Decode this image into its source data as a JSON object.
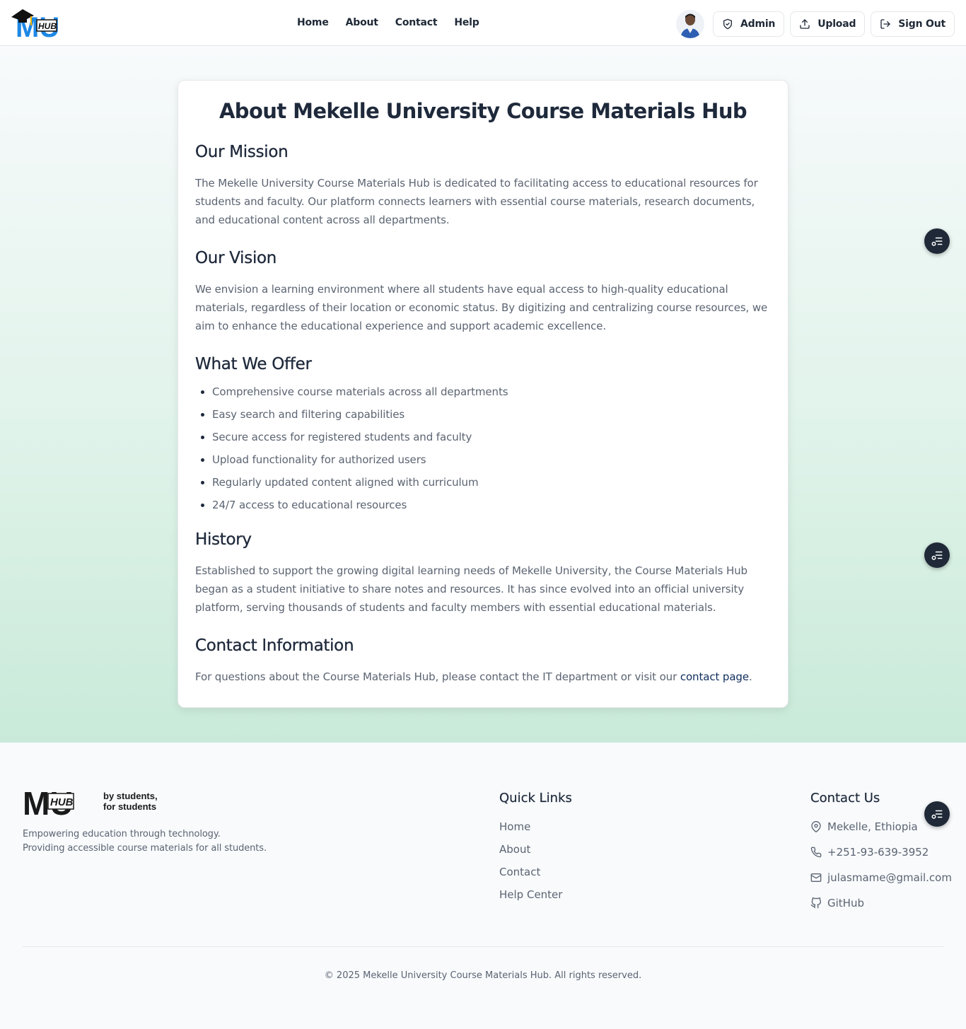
{
  "nav": {
    "links": [
      "Home",
      "About",
      "Contact",
      "Help"
    ],
    "admin_label": "Admin",
    "upload_label": "Upload",
    "signout_label": "Sign Out"
  },
  "content": {
    "title": "About Mekelle University Course Materials Hub",
    "mission_heading": "Our Mission",
    "mission_text": "The Mekelle University Course Materials Hub is dedicated to facilitating access to educational resources for students and faculty. Our platform connects learners with essential course materials, research documents, and educational content across all departments.",
    "vision_heading": "Our Vision",
    "vision_text": "We envision a learning environment where all students have equal access to high-quality educational materials, regardless of their location or economic status. By digitizing and centralizing course resources, we aim to enhance the educational experience and support academic excellence.",
    "offer_heading": "What We Offer",
    "offer_items": [
      "Comprehensive course materials across all departments",
      "Easy search and filtering capabilities",
      "Secure access for registered students and faculty",
      "Upload functionality for authorized users",
      "Regularly updated content aligned with curriculum",
      "24/7 access to educational resources"
    ],
    "history_heading": "History",
    "history_text": "Established to support the growing digital learning needs of Mekelle University, the Course Materials Hub began as a student initiative to share notes and resources. It has since evolved into an official university platform, serving thousands of students and faculty members with essential educational materials.",
    "contact_heading": "Contact Information",
    "contact_text_before": "For questions about the Course Materials Hub, please contact the IT department or visit our ",
    "contact_link": "contact page",
    "contact_text_after": "."
  },
  "footer": {
    "logo_text": "MU",
    "logo_hub": "HUB",
    "logo_tagline_1": "by students,",
    "logo_tagline_2": "for students",
    "tagline_1": "Empowering education through technology.",
    "tagline_2": "Providing accessible course materials for all students.",
    "quick_links_title": "Quick Links",
    "quick_links": [
      "Home",
      "About",
      "Contact",
      "Help Center"
    ],
    "contact_title": "Contact Us",
    "location": "Mekelle, Ethiopia",
    "phone": "+251-93-639-3952",
    "email": "julasmame@gmail.com",
    "github": "GitHub",
    "copyright": "© 2025 Mekelle University Course Materials Hub. All rights reserved."
  },
  "header_logo": {
    "text": "MU",
    "hub": "HUB"
  },
  "colors": {
    "accent_blue": "#1e88e5",
    "dark": "#1f2937",
    "link": "#0f2d5c"
  }
}
